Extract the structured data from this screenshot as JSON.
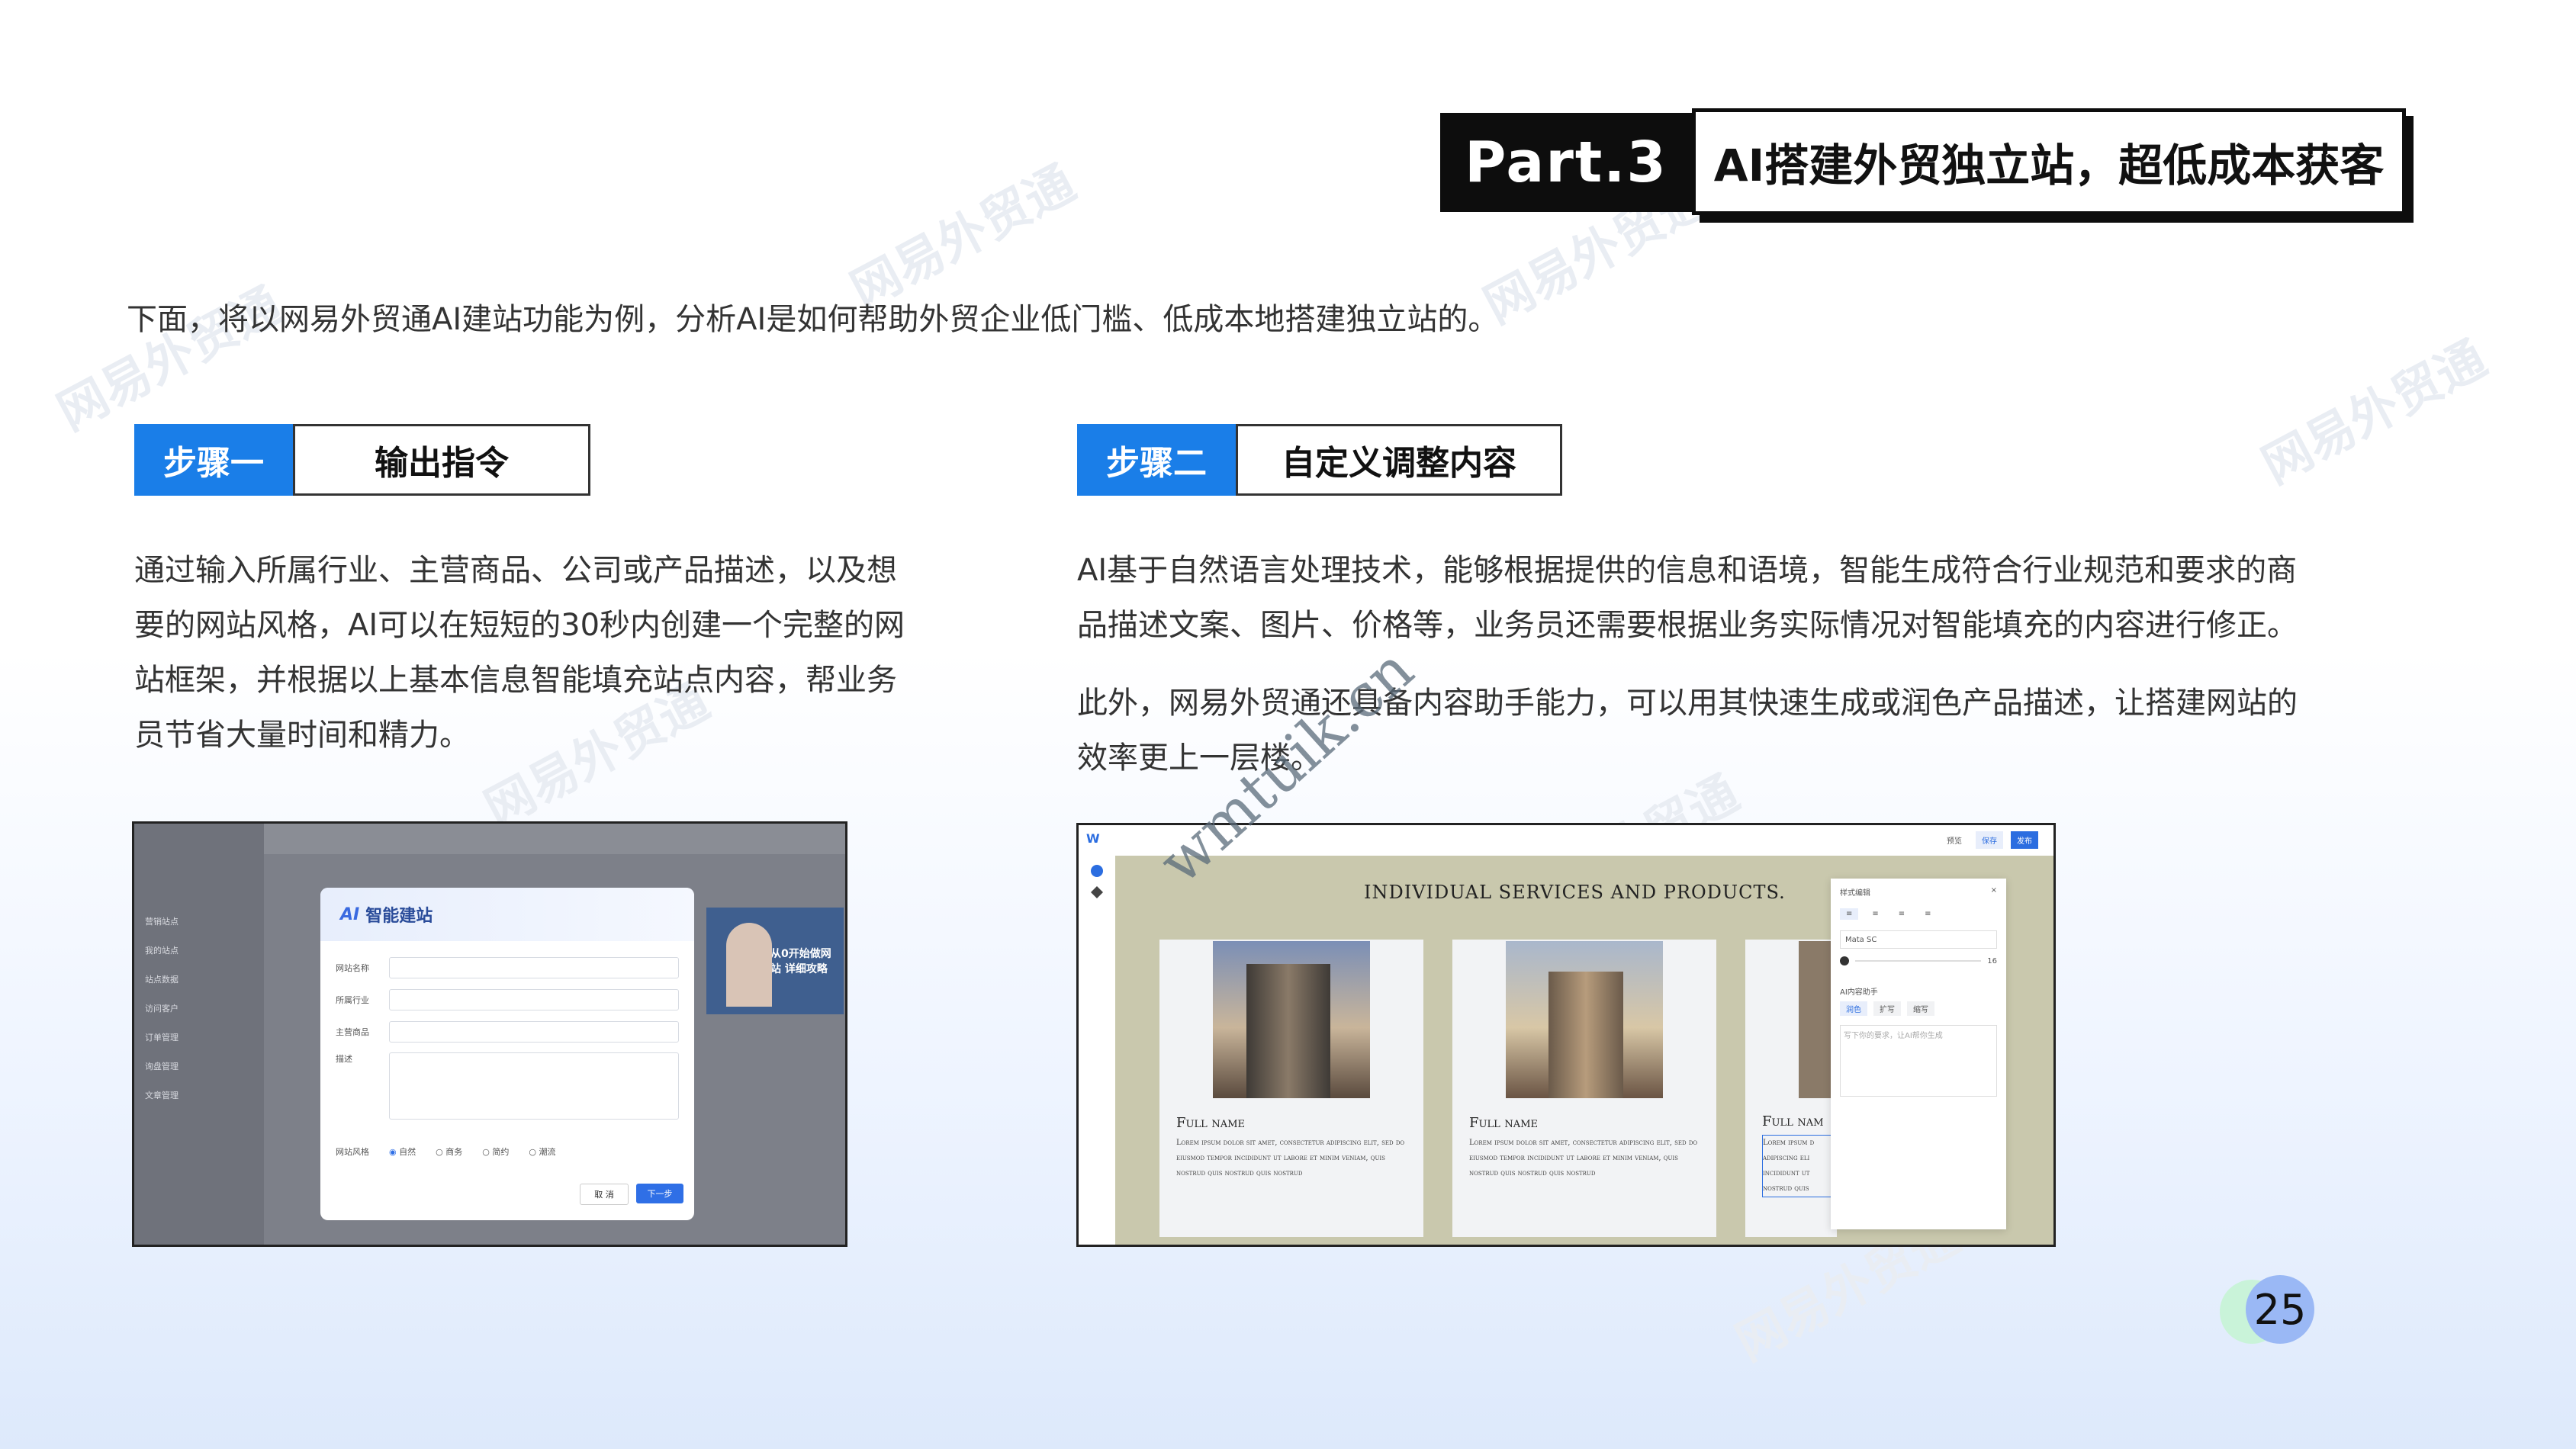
{
  "header": {
    "part_label": "Part.3",
    "title": "AI搭建外贸独立站，超低成本获客"
  },
  "intro": "下面，将以网易外贸通AI建站功能为例，分析AI是如何帮助外贸企业低门槛、低成本地搭建独立站的。",
  "step1": {
    "tag": "步骤一",
    "title": "输出指令",
    "lines": [
      "通过输入所属行业、主营商品、公司或产品描述，以及想",
      "要的网站风格，AI可以在短短的30秒内创建一个完整的网",
      "站框架，并根据以上基本信息智能填充站点内容，帮业务",
      "员节省大量时间和精力。"
    ]
  },
  "step2": {
    "tag": "步骤二",
    "title": "自定义调整内容",
    "p1_lines": [
      "AI基于自然语言处理技术，能够根据提供的信息和语境，智能生成符合行业规范和要求的商",
      "品描述文案、图片、价格等，业务员还需要根据业务实际情况对智能填充的内容进行修正。"
    ],
    "p2_lines": [
      "此外，网易外贸通还具备内容助手能力，可以用其快速生成或润色产品描述，让搭建网站的",
      "效率更上一层楼。"
    ]
  },
  "shot1": {
    "dialog_title": "智能建站",
    "fields": [
      "网站名称",
      "所属行业",
      "主营商品",
      "描述"
    ],
    "style_label": "网站风格",
    "styles": [
      "自然",
      "商务",
      "简约",
      "潮流"
    ],
    "cancel": "取 消",
    "ok": "下一步",
    "side_items": [
      "营销站点",
      "我的站点",
      "站点数据",
      "访问客户",
      "订单管理",
      "询盘管理",
      "文章管理"
    ],
    "promo": "从0开始做网站 详细攻略"
  },
  "shot2": {
    "heading": "INDIVIDUAL SERVICES AND PRODUCTS.",
    "cards": [
      {
        "name": "Full name",
        "desc": "Lorem ipsum dolor sit amet, consectetur adipiscing elit, sed do eiusmod tempor incididunt ut labore et minim veniam, quis nostrud quis nostrud quis nostrud"
      },
      {
        "name": "Full name",
        "desc": "Lorem ipsum dolor sit amet, consectetur adipiscing elit, sed do eiusmod tempor incididunt ut labore et minim veniam, quis nostrud quis nostrud quis nostrud"
      },
      {
        "name": "Full nam",
        "desc": "Lorem ipsum d adipiscing eli incididunt ut nostrud quis"
      }
    ],
    "panel_title": "样式编辑",
    "panel_font": "Mata SC",
    "panel_size": "16",
    "panel_ai": "AI内容助手",
    "panel_btns": [
      "润色",
      "扩写",
      "缩写"
    ],
    "panel_placeholder": "写下你的要求，让AI帮你生成",
    "toolbar": [
      "预览",
      "保存",
      "发布"
    ]
  },
  "watermark": "网易外贸通",
  "wm_url": "wmtuik.cn",
  "page_number": "25",
  "colors": {
    "accent": "#1a7ee8",
    "black": "#0d0d0d",
    "olive_bg": "#c9c8ad"
  }
}
